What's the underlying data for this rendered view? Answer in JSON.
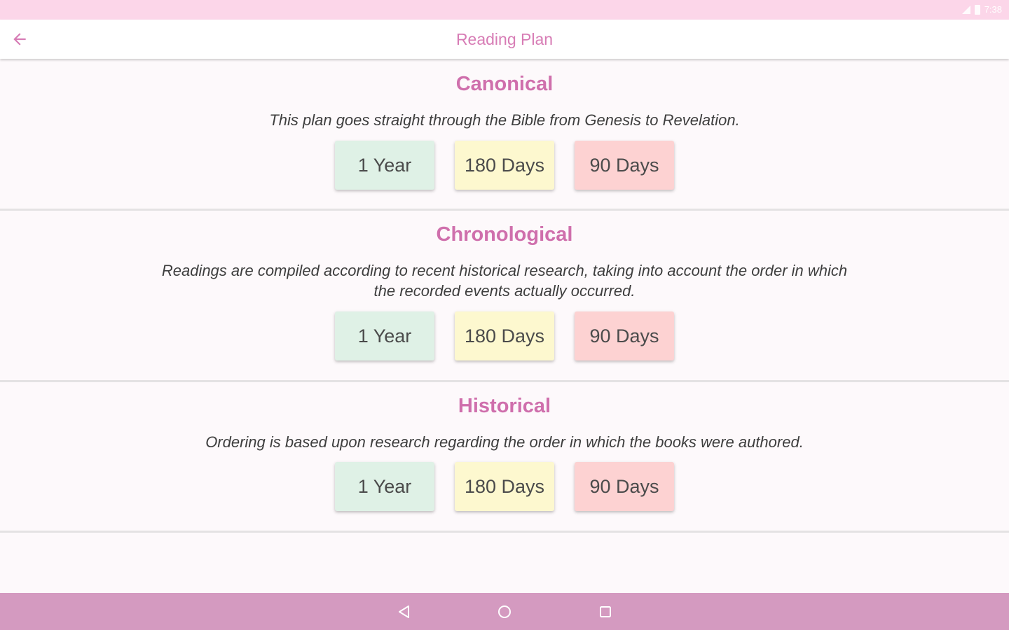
{
  "status_bar": {
    "time": "7:38",
    "bg_color": "#fcd6e9",
    "icons": [
      "signal-icon",
      "battery-icon"
    ]
  },
  "app_bar": {
    "title": "Reading Plan",
    "back_icon": "arrow-back-icon",
    "title_color": "#d77cb5"
  },
  "sections": [
    {
      "title": "Canonical",
      "description": "This plan goes straight through the Bible from Genesis to Revelation.",
      "buttons": [
        {
          "label": "1 Year",
          "color": "#dff1e6"
        },
        {
          "label": "180 Days",
          "color": "#fdf8cf"
        },
        {
          "label": "90 Days",
          "color": "#fdd2d2"
        }
      ]
    },
    {
      "title": "Chronological",
      "description": "Readings are compiled according to recent historical research, taking into account the order in which the recorded events actually occurred.",
      "buttons": [
        {
          "label": "1 Year",
          "color": "#dff1e6"
        },
        {
          "label": "180 Days",
          "color": "#fdf8cf"
        },
        {
          "label": "90 Days",
          "color": "#fdd2d2"
        }
      ]
    },
    {
      "title": "Historical",
      "description": "Ordering is based upon research regarding the order in which the books were authored.",
      "buttons": [
        {
          "label": "1 Year",
          "color": "#dff1e6"
        },
        {
          "label": "180 Days",
          "color": "#fdf8cf"
        },
        {
          "label": "90 Days",
          "color": "#fdd2d2"
        }
      ]
    }
  ],
  "nav_bar": {
    "bg_color": "#d49ac0",
    "buttons": [
      "nav-back-icon",
      "nav-home-icon",
      "nav-recents-icon"
    ]
  }
}
